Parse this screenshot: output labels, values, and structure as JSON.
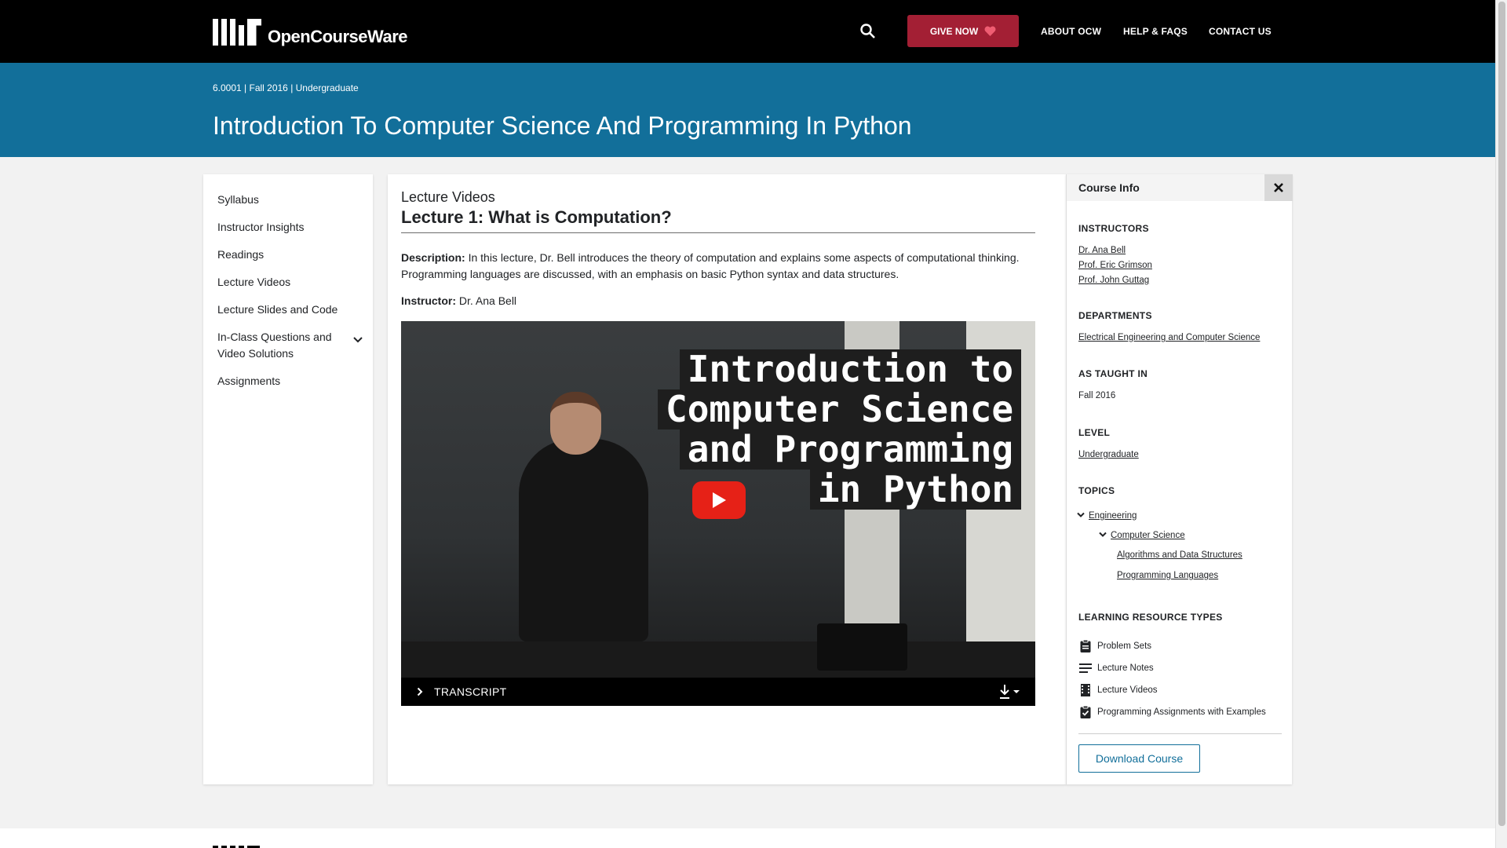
{
  "header": {
    "logo_text": "OpenCourseWare",
    "give_now": "GIVE NOW",
    "nav": [
      "ABOUT OCW",
      "HELP & FAQS",
      "CONTACT US"
    ]
  },
  "banner": {
    "breadcrumb": "6.0001 | Fall 2016 | Undergraduate",
    "title": "Introduction To Computer Science And Programming In Python"
  },
  "sidebar": {
    "items": [
      {
        "label": "Syllabus"
      },
      {
        "label": "Instructor Insights"
      },
      {
        "label": "Readings"
      },
      {
        "label": "Lecture Videos"
      },
      {
        "label": "Lecture Slides and Code"
      },
      {
        "label": "In-Class Questions and Video Solutions"
      },
      {
        "label": "Assignments"
      }
    ]
  },
  "main": {
    "section": "Lecture Videos",
    "title": "Lecture 1: What is Computation?",
    "description_label": "Description:",
    "description": " In this lecture, Dr. Bell introduces the theory of computation and explains some aspects of computational thinking. Programming languages are discussed, with an emphasis on basic Python syntax and data structures.",
    "instructor_label": "Instructor:",
    "instructor": " Dr. Ana Bell",
    "video_overlay": [
      "Introduction to",
      "Computer Science",
      "and Programming",
      "in Python"
    ],
    "transcript": "TRANSCRIPT"
  },
  "course_info": {
    "heading": "Course Info",
    "instructors_heading": "INSTRUCTORS",
    "instructors": [
      "Dr. Ana Bell",
      "Prof. Eric Grimson",
      "Prof. John Guttag"
    ],
    "departments_heading": "DEPARTMENTS",
    "department": "Electrical Engineering and Computer Science",
    "taught_heading": "AS TAUGHT IN",
    "taught": "Fall 2016",
    "level_heading": "LEVEL",
    "level": "Undergraduate",
    "topics_heading": "TOPICS",
    "topics": {
      "root": "Engineering",
      "sub": "Computer Science",
      "leaves": [
        "Algorithms and Data Structures",
        "Programming Languages"
      ]
    },
    "resources_heading": "LEARNING RESOURCE TYPES",
    "resources": [
      {
        "label": "Problem Sets",
        "icon": "clipboard-icon"
      },
      {
        "label": "Lecture Notes",
        "icon": "notes-icon"
      },
      {
        "label": "Lecture Videos",
        "icon": "film-icon"
      },
      {
        "label": "Programming Assignments with Examples",
        "icon": "clipboard-check-icon"
      }
    ],
    "download": "Download Course"
  },
  "colors": {
    "banner": "#126f9a",
    "give_now": "#a31f34",
    "play": "#e62117"
  }
}
